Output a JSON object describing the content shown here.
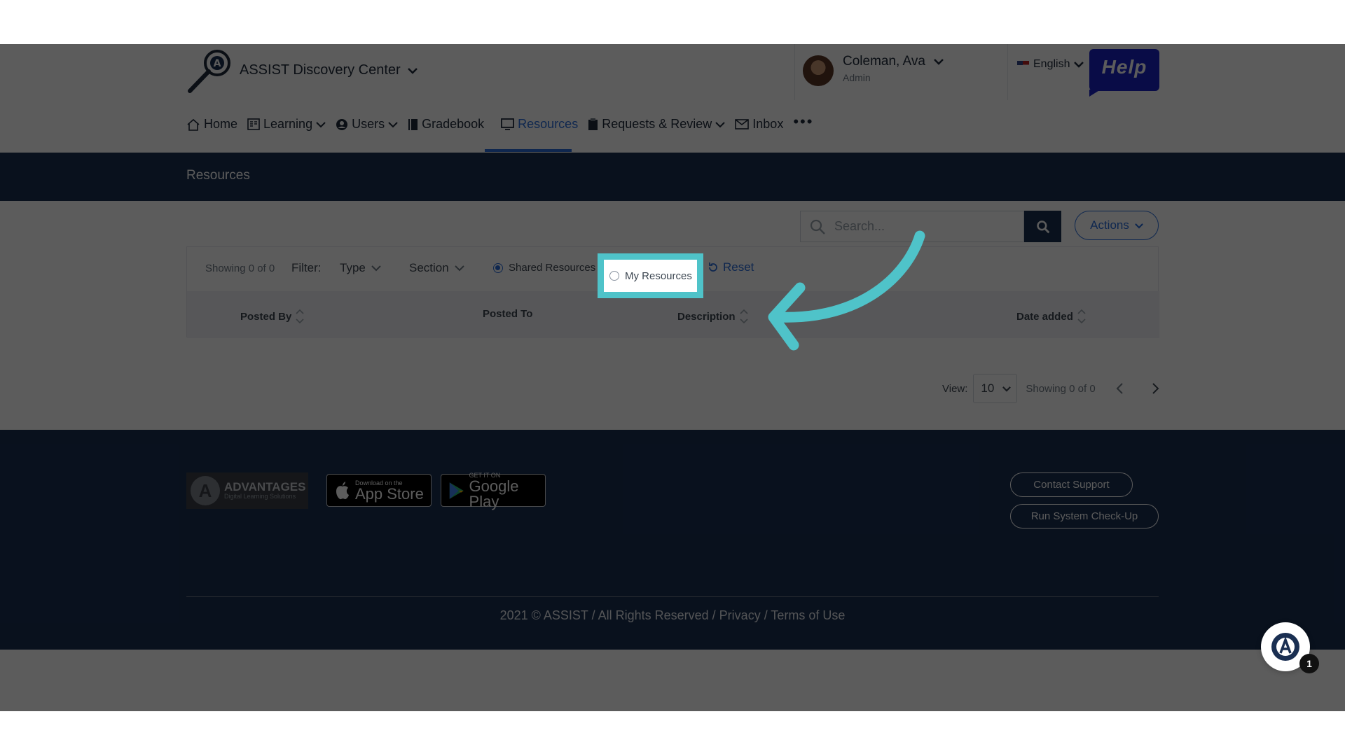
{
  "header": {
    "app_title": "ASSIST Discovery Center",
    "user_name": "Coleman, Ava",
    "user_role": "Admin",
    "language": "English",
    "help_label": "Help"
  },
  "nav": [
    {
      "label": "Home",
      "icon": "home-icon"
    },
    {
      "label": "Learning",
      "icon": "learning-icon",
      "dropdown": true
    },
    {
      "label": "Users",
      "icon": "user-icon",
      "dropdown": true
    },
    {
      "label": "Gradebook",
      "icon": "book-icon"
    },
    {
      "label": "Resources",
      "icon": "resources-icon",
      "active": true
    },
    {
      "label": "Requests & Review",
      "icon": "clipboard-icon",
      "dropdown": true
    },
    {
      "label": "Inbox",
      "icon": "mail-icon"
    }
  ],
  "page_title": "Resources",
  "search": {
    "placeholder": "Search..."
  },
  "actions_label": "Actions",
  "filter": {
    "showing": "Showing 0 of 0",
    "label": "Filter:",
    "type_label": "Type",
    "section_label": "Section",
    "shared_resources": "Shared Resources",
    "my_resources": "My Resources",
    "reset": "Reset"
  },
  "table": {
    "columns": [
      "Posted By",
      "Posted To",
      "Description",
      "Date added"
    ]
  },
  "pager": {
    "view_label": "View:",
    "view_value": "10",
    "showing": "Showing 0 of 0"
  },
  "footer": {
    "brand_name": "ADVANTAGES",
    "brand_tagline": "Digital Learning Solutions",
    "app_store_small": "Download on the",
    "app_store_big": "App Store",
    "google_small": "GET IT ON",
    "google_big": "Google Play",
    "contact_support": "Contact Support",
    "system_checkup": "Run System Check-Up",
    "copyright": "2021 © ASSIST / All Rights Reserved / Privacy / Terms of Use"
  },
  "chat": {
    "badge_count": "1"
  },
  "colors": {
    "primary_dark": "#1a2f52",
    "accent_blue": "#2a6edb",
    "highlight_teal": "#4fc3c9",
    "help_blue": "#1a22c4"
  }
}
